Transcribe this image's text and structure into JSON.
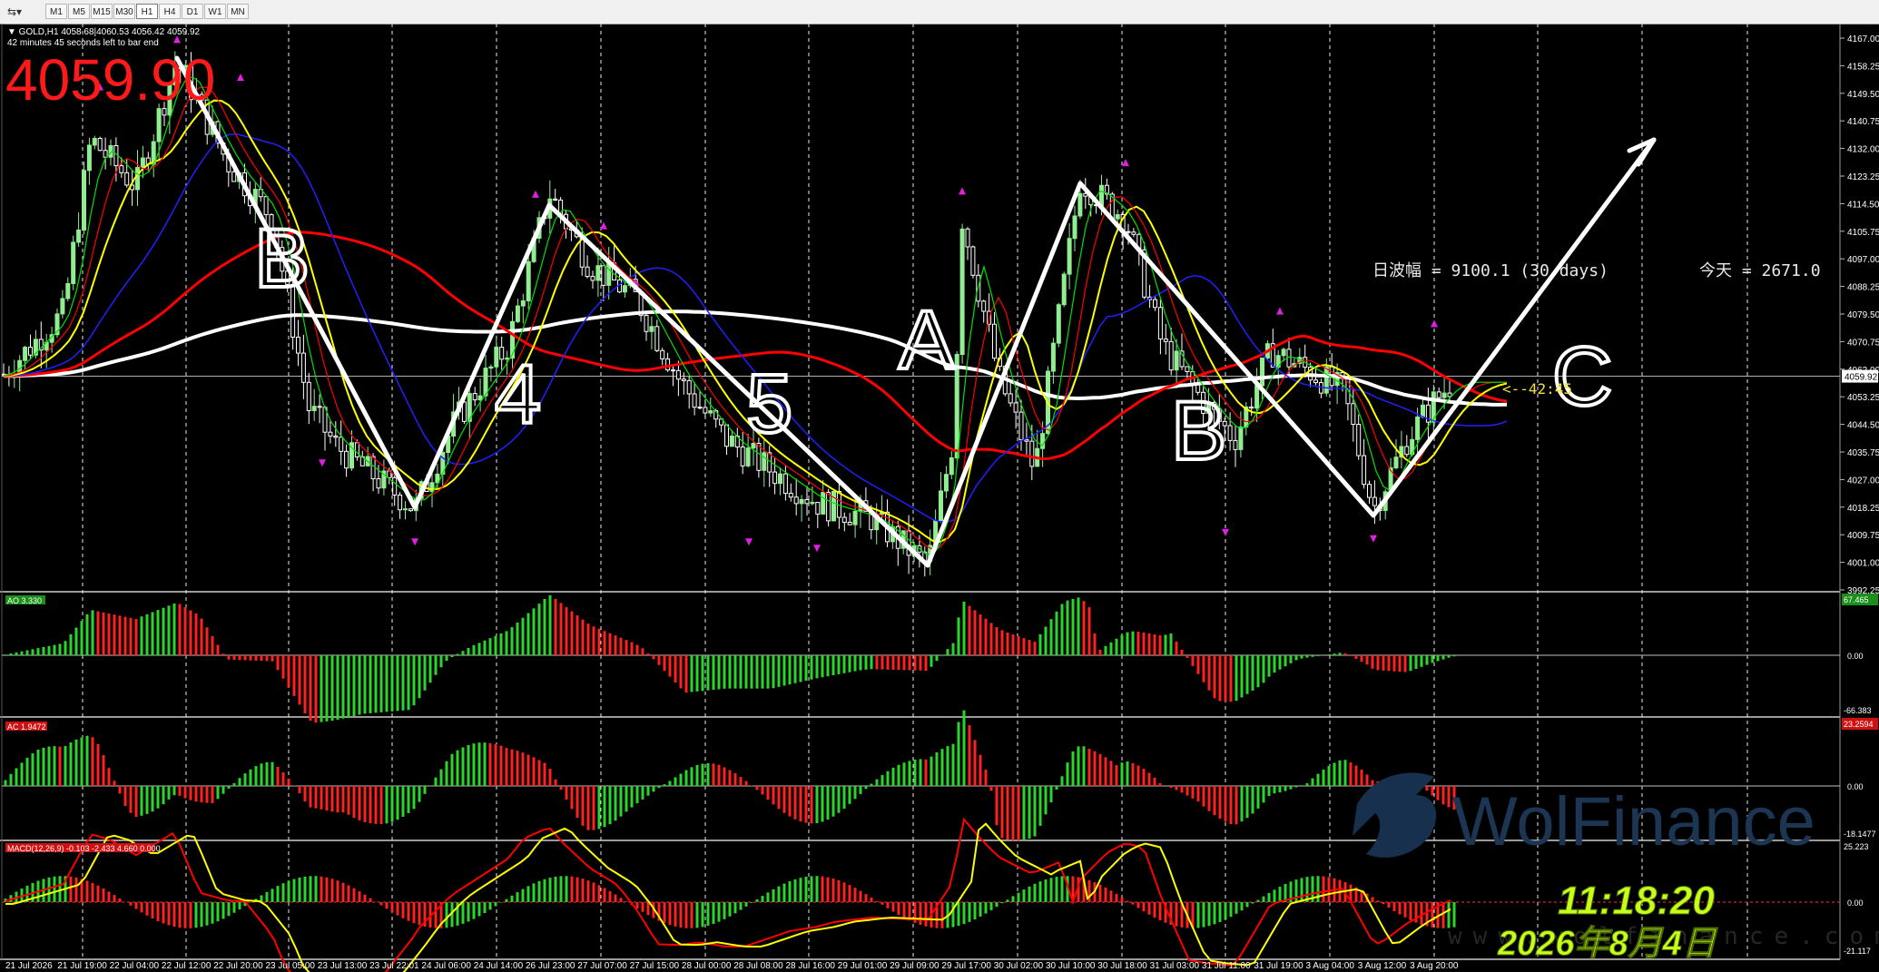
{
  "toolbar": {
    "timeframes": [
      "M1",
      "M5",
      "M15",
      "M30",
      "H1",
      "H4",
      "D1",
      "W1",
      "MN"
    ],
    "active": "H1"
  },
  "header": {
    "symbol_line": "▼ GOLD,H1  4058.68|4060.53 4056.42 4059.92",
    "timer_line": "42 minutes 45 seconds left to bar end",
    "big_price": "4059.90"
  },
  "overlay": {
    "range_text": "日波幅 = 9100.1  (30 days)",
    "today_text": "今天 = 2671.0",
    "countdown": "<--42:45",
    "clock": "11:18:20",
    "date": "2026年8月4日",
    "watermark": "WolFinance",
    "watermark_url": "www.wolfinance.com"
  },
  "annotations": [
    "B",
    "4",
    "5",
    "A",
    "B",
    "C"
  ],
  "price_axis": {
    "labels": [
      "4167.00",
      "4158.25",
      "4149.50",
      "4140.75",
      "4132.00",
      "4123.25",
      "4114.50",
      "4105.75",
      "4097.00",
      "4088.25",
      "4079.50",
      "4070.75",
      "4062.00",
      "4053.25",
      "4044.50",
      "4035.75",
      "4027.00",
      "4018.25",
      "4009.75",
      "4001.00",
      "3992.25"
    ],
    "current": "4059.92"
  },
  "time_axis": [
    "21 Jul 2026",
    "21 Jul 19:00",
    "22 Jul 04:00",
    "22 Jul 12:00",
    "22 Jul 20:00",
    "23 Jul 05:00",
    "23 Jul 13:00",
    "23 Jul 22:01",
    "24 Jul 06:00",
    "24 Jul 14:00",
    "26 Jul 23:00",
    "27 Jul 07:00",
    "27 Jul 15:00",
    "28 Jul 00:00",
    "28 Jul 08:00",
    "28 Jul 16:00",
    "29 Jul 01:00",
    "29 Jul 09:00",
    "29 Jul 17:00",
    "30 Jul 02:00",
    "30 Jul 10:00",
    "30 Jul 18:00",
    "31 Jul 03:00",
    "31 Jul 11:00",
    "31 Jul 19:00",
    "3 Aug 04:00",
    "3 Aug 12:00",
    "3 Aug 20:00"
  ],
  "indicators": {
    "ao": {
      "label": "AO 3.330",
      "top": "67.465",
      "zero": "0.00",
      "bottom": "-66.383"
    },
    "ac": {
      "label": "AC 1.9472",
      "top": "23.2594",
      "zero": "0.00",
      "bottom": "-18.1477"
    },
    "macd": {
      "label": "MACD(12,26,9) -0.103 -2.433 4.660 0.000",
      "top": "25.223",
      "zero": "0.00",
      "bottom": "-21.117"
    }
  },
  "colors": {
    "bull": "#2bd62b",
    "bear": "#ff2020",
    "up_candle": "#90ee90",
    "text_red": "#ff1a1a",
    "clock": "#c8ff1a",
    "ma_white": "#ffffff",
    "ma_red": "#ff0000",
    "ma_yellow": "#ffff00",
    "ma_green": "#00e000",
    "ma_blue": "#2020ff"
  }
}
